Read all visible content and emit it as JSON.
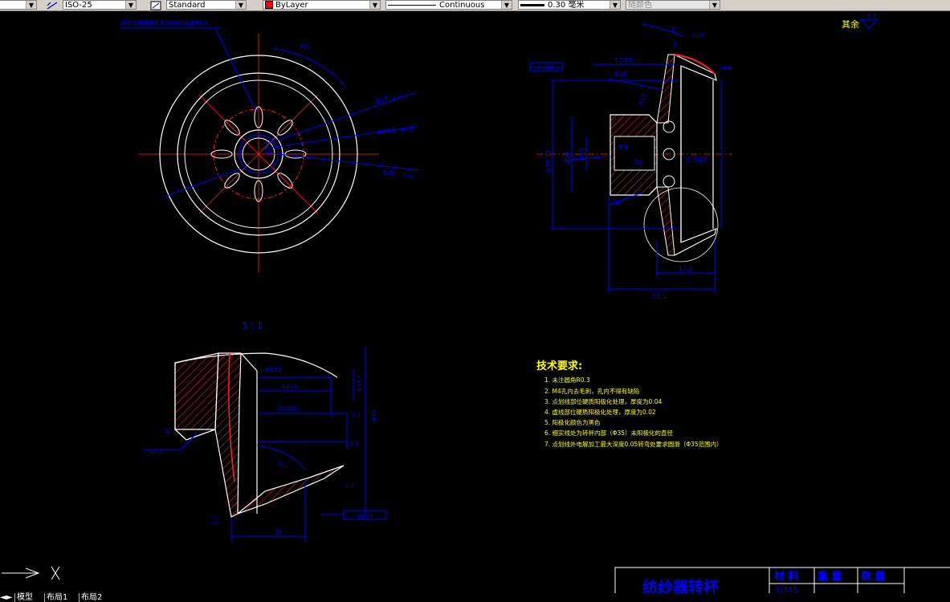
{
  "toolbar": {
    "dimstyle": "ISO-25",
    "textstyle": "Standard",
    "layer": "ByLayer",
    "linetype": "Continuous",
    "lineweight": "0.30 毫米",
    "plotstyle": "随颜色"
  },
  "drawing": {
    "top_view_note": "去毛口电解去毛刺深0.05两端R0.3",
    "surface_note": "其余",
    "surface_sym": "6.3",
    "scale_label": "5 : 1",
    "dims_top": {
      "angle": "45°",
      "d57": "Φ57",
      "d46": "Φ46.2",
      "d40": "Φ40",
      "ft1": "-0.03",
      "ft2": "-0.05",
      "ft3": "-0.02"
    },
    "dims_side": {
      "tol": "0.004",
      "l17": "17.05",
      "r29": "R29",
      "ang8": "8°",
      "d35": "Φ35.11",
      "d26": "Φ26",
      "len": "31.1",
      "w": "17.5",
      "r15": "R15",
      "m4": "M4",
      "r6": "R6",
      "d12": "Φ12",
      "hole": "0.5深6",
      "lead": "36°",
      "extra1": "0.05",
      "extra2": "9.5"
    },
    "dims_detail": {
      "r0": "R0.75",
      "l9": "9.814",
      "l11": "11.523",
      "d35": "Φ35.7",
      "d36": "Φ36",
      "s1": "1.2",
      "s2": "0.5",
      "ang": "50°",
      "r02": "R0.2",
      "ang2": "8°",
      "l16": "16",
      "tol": "0.004",
      "small": "0.5",
      "c1": "0.3"
    },
    "tech_req": {
      "title": "技术要求:",
      "items": [
        "1. 未注圆角R0.3",
        "2. M4孔内去毛刺，孔内不得有缺陷",
        "3. 点划线部位硬质阳极化处理，厚度为0.04",
        "4. 虚线部位硬质阳极化处理，厚度为0.02",
        "5. 阳极化颜色为黑色",
        "6. 细实线处为转杯内部（Φ35）未阳极化的直径",
        "7. 点划线外电解加工最大深度0.05转弯处要求圆滑（Φ35范围内）"
      ]
    },
    "title_block": {
      "part_name": "纺纱器转杯",
      "material_label": "材 料",
      "weight_label": "重 量",
      "qty_label": "数 量",
      "scale_value": "1/345"
    }
  },
  "tabs": [
    "模型",
    "布局1",
    "布局2"
  ],
  "colors": {
    "outline": "#ffffff",
    "centerline": "#ff0000",
    "dimension": "#0000ff",
    "hatch": "#ff0000",
    "text": "#ffff00",
    "title": "#0000ff"
  }
}
